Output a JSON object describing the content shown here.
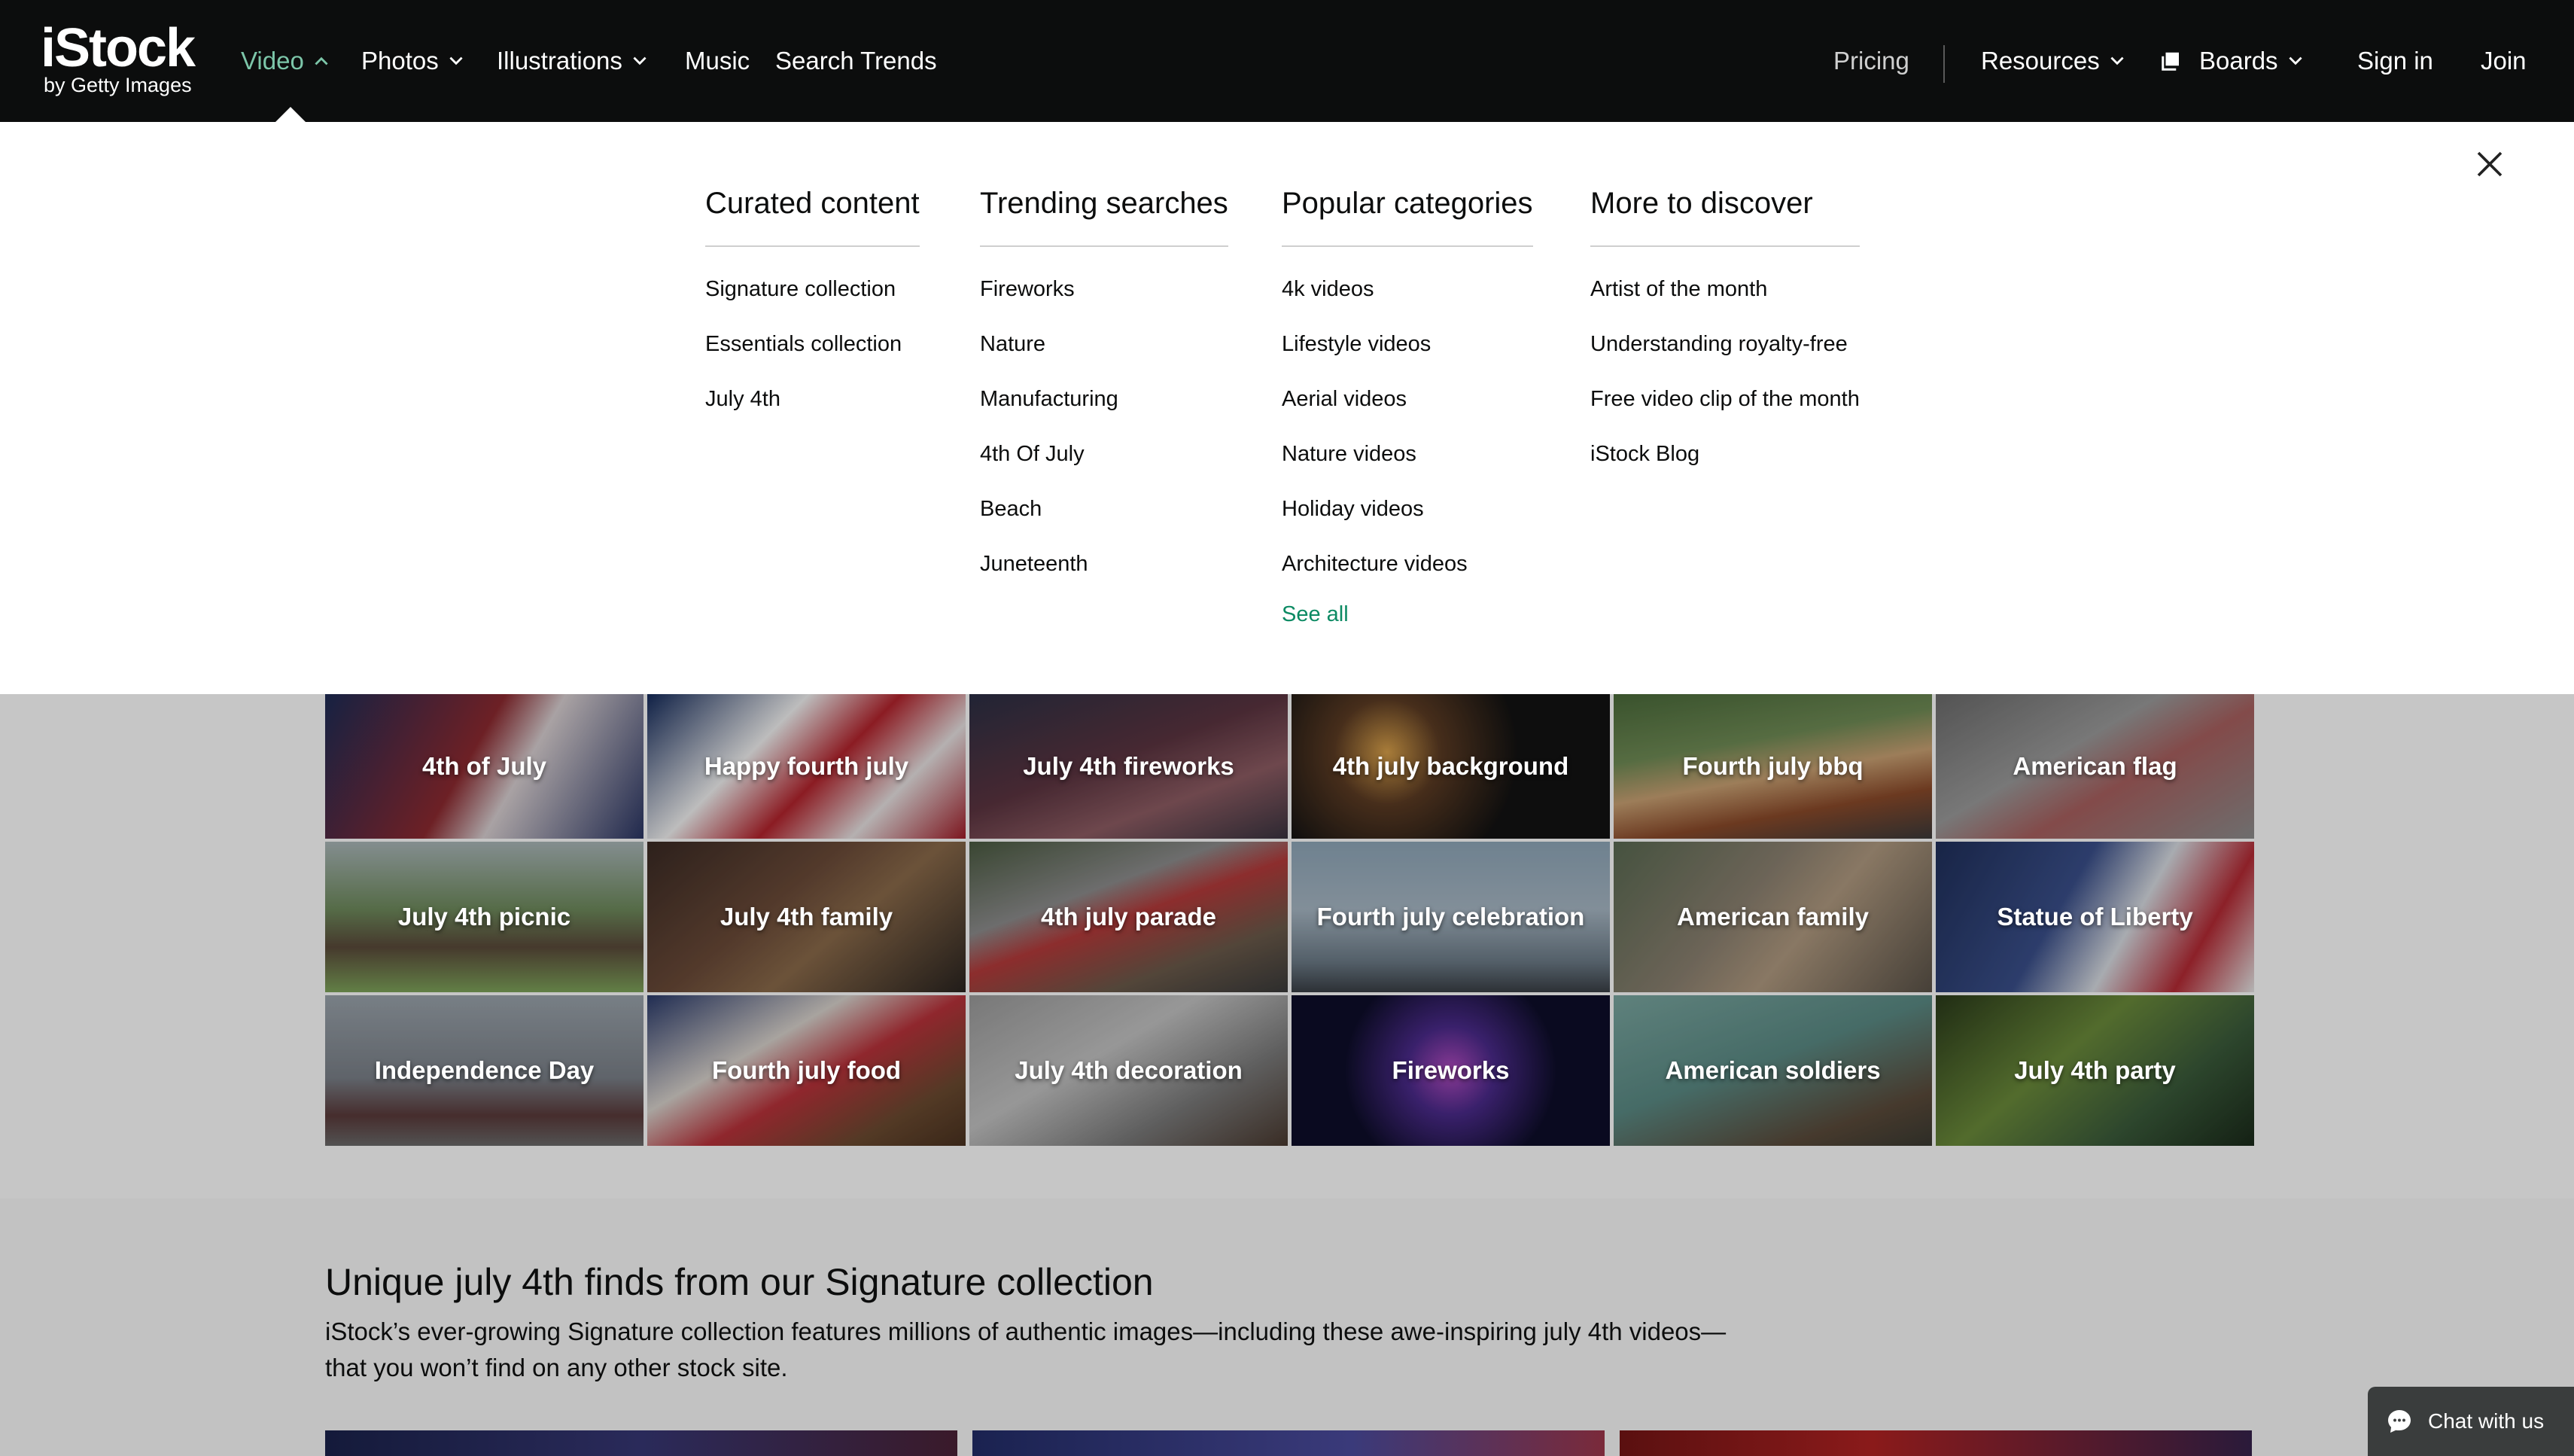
{
  "brand": {
    "name": "iStock",
    "sub": "by Getty Images"
  },
  "nav": {
    "left": [
      {
        "label": "Video",
        "active": true,
        "chevron": "up"
      },
      {
        "label": "Photos",
        "chevron": "down"
      },
      {
        "label": "Illustrations",
        "chevron": "down"
      },
      {
        "label": "Music"
      },
      {
        "label": "Search Trends"
      }
    ],
    "pricing": "Pricing",
    "resources": "Resources",
    "boards": "Boards",
    "signin": "Sign in",
    "join": "Join",
    "active_color": "#7cc6a9"
  },
  "menu": {
    "columns": [
      {
        "heading": "Curated content",
        "items": [
          "Signature collection",
          "Essentials collection",
          "July 4th"
        ]
      },
      {
        "heading": "Trending searches",
        "items": [
          "Fireworks",
          "Nature",
          "Manufacturing",
          "4th Of July",
          "Beach",
          "Juneteenth"
        ]
      },
      {
        "heading": "Popular categories",
        "items": [
          "4k videos",
          "Lifestyle videos",
          "Aerial videos",
          "Nature videos",
          "Holiday videos",
          "Architecture videos"
        ],
        "see_all": "See all"
      },
      {
        "heading": "More to discover",
        "items": [
          "Artist of the month",
          "Understanding royalty-free",
          "Free video clip of the month",
          "iStock Blog"
        ]
      }
    ]
  },
  "tiles": [
    "4th of July",
    "Happy fourth july",
    "July 4th fireworks",
    "4th july background",
    "Fourth july bbq",
    "American flag",
    "July 4th picnic",
    "July 4th family",
    "4th july parade",
    "Fourth july celebration",
    "American family",
    "Statue of Liberty",
    "Independence Day",
    "Fourth july food",
    "July 4th decoration",
    "Fireworks",
    "American soldiers",
    "July 4th party"
  ],
  "signature": {
    "title": "Unique july 4th finds from our Signature collection",
    "description": "iStock’s ever-growing Signature collection features millions of authentic images—including these awe-inspiring july 4th videos—that you won’t find on any other stock site."
  },
  "chat": {
    "label": "Chat with us"
  }
}
